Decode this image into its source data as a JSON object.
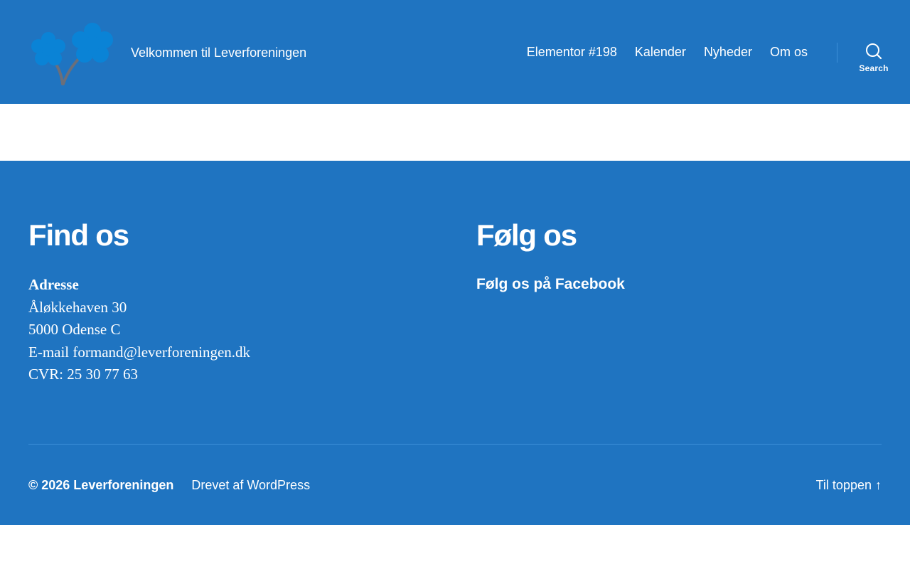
{
  "header": {
    "logo_icon": "forget-me-not-flowers-icon",
    "tagline": "Velkommen til Leverforeningen",
    "nav": [
      {
        "label": "Elementor #198"
      },
      {
        "label": "Kalender"
      },
      {
        "label": "Nyheder"
      },
      {
        "label": "Om os"
      }
    ],
    "search_label": "Search"
  },
  "footer": {
    "find_title": "Find os",
    "address_heading": "Adresse",
    "address_lines": [
      "Åløkkehaven 30",
      "5000 Odense C",
      "E-mail formand@leverforeningen.dk",
      "CVR: 25 30 77 63"
    ],
    "follow_title": "Følg os",
    "facebook_link": "Følg os på Facebook",
    "copyright": "© 2026 Leverforeningen",
    "powered_by": "Drevet af WordPress",
    "to_top": "Til toppen ↑"
  },
  "colors": {
    "brand_blue": "#1f74c1",
    "logo_flower": "#0a83d6",
    "logo_stem": "#6b6f7a"
  }
}
